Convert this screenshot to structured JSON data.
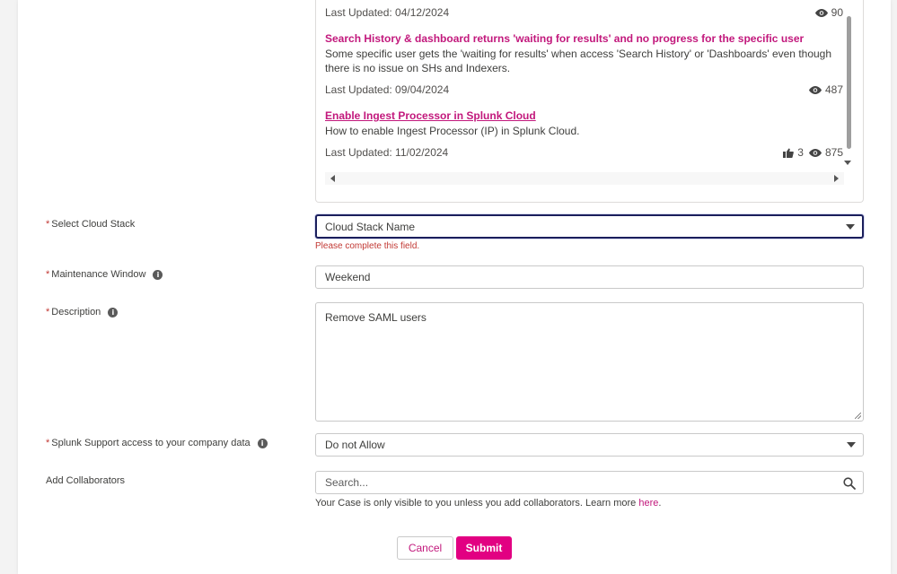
{
  "articles": [
    {
      "last_updated": "Last Updated: 04/12/2024",
      "views": "90"
    },
    {
      "title": "Search History & dashboard returns 'waiting for results' and no progress for the specific user",
      "description": "Some specific user gets the 'waiting for results' when access 'Search History' or 'Dashboards' even though there is no issue on SHs and Indexers.",
      "last_updated": "Last Updated: 09/04/2024",
      "views": "487"
    },
    {
      "title": "Enable Ingest Processor in Splunk Cloud",
      "description": "How to enable Ingest Processor (IP) in Splunk Cloud.",
      "last_updated": "Last Updated: 11/02/2024",
      "likes": "3",
      "views": "875"
    }
  ],
  "form": {
    "required_mark": "*",
    "cloud_stack": {
      "label": "Select Cloud Stack",
      "value": "Cloud Stack Name",
      "error": "Please complete this field."
    },
    "maintenance_window": {
      "label": "Maintenance Window",
      "value": "Weekend"
    },
    "description": {
      "label": "Description",
      "value": "Remove SAML users"
    },
    "support_access": {
      "label": "Splunk Support access to your company data",
      "value": "Do not Allow"
    },
    "collaborators": {
      "label": "Add Collaborators",
      "placeholder": "Search...",
      "hint": "Your Case is only visible to you unless you add collaborators. Learn more ",
      "hint_link": "here",
      "hint_end": "."
    },
    "info_glyph": "i"
  },
  "buttons": {
    "cancel": "Cancel",
    "submit": "Submit"
  },
  "colors": {
    "accent": "#e20082",
    "link": "#c2187c",
    "error": "#c23934",
    "focus_border": "#1b1f5c"
  }
}
